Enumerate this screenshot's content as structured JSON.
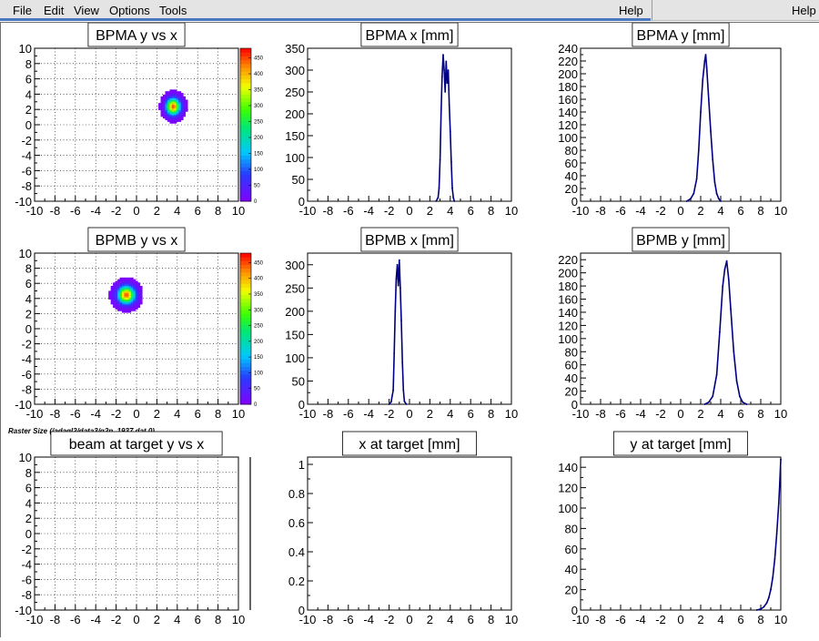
{
  "menu": {
    "items": [
      "File",
      "Edit",
      "View",
      "Options",
      "Tools"
    ],
    "help_left": "Help",
    "help_right": "Help"
  },
  "note": "Raster Size (/adaql2/data3/g2p_1937.dat.0)",
  "colors": {
    "frame": "#000000",
    "grid": "#000000",
    "hist": "#000080"
  },
  "chart_data": [
    {
      "id": "bpma-yx",
      "type": "heatmap",
      "title": "BPMA y vs x",
      "xlim": [
        -10,
        10
      ],
      "ylim": [
        -10,
        10
      ],
      "xticks": [
        -10,
        -8,
        -6,
        -4,
        -2,
        0,
        2,
        4,
        6,
        8,
        10
      ],
      "yticks": [
        -10,
        -8,
        -6,
        -4,
        -2,
        0,
        2,
        4,
        6,
        8,
        10
      ],
      "grid": true,
      "blob": {
        "cx": 3.5,
        "cy": 2.3,
        "sx": 0.45,
        "sy": 0.7,
        "peak": 450
      },
      "palette": {
        "min": 0,
        "max": 480,
        "ticks": [
          0,
          50,
          100,
          150,
          200,
          250,
          300,
          350,
          400,
          450
        ]
      }
    },
    {
      "id": "bpma-x",
      "type": "line",
      "title": "BPMA x [mm]",
      "xlim": [
        -10,
        10
      ],
      "ylim": [
        0,
        350
      ],
      "xticks": [
        -10,
        -8,
        -6,
        -4,
        -2,
        0,
        2,
        4,
        6,
        8,
        10
      ],
      "yticks": [
        0,
        50,
        100,
        150,
        200,
        250,
        300,
        350
      ],
      "grid": false,
      "x": [
        2.6,
        2.8,
        2.9,
        3.0,
        3.1,
        3.2,
        3.3,
        3.4,
        3.5,
        3.6,
        3.7,
        3.8,
        3.9,
        4.0,
        4.1,
        4.2,
        4.3,
        4.4
      ],
      "y": [
        0,
        8,
        30,
        95,
        200,
        285,
        335,
        300,
        250,
        320,
        270,
        300,
        220,
        160,
        90,
        30,
        8,
        0
      ]
    },
    {
      "id": "bpma-y",
      "type": "line",
      "title": "BPMA y [mm]",
      "xlim": [
        -10,
        10
      ],
      "ylim": [
        0,
        240
      ],
      "xticks": [
        -10,
        -8,
        -6,
        -4,
        -2,
        0,
        2,
        4,
        6,
        8,
        10
      ],
      "yticks": [
        0,
        20,
        40,
        60,
        80,
        100,
        120,
        140,
        160,
        180,
        200,
        220,
        240
      ],
      "grid": false,
      "x": [
        0.6,
        1.0,
        1.3,
        1.6,
        1.8,
        2.0,
        2.2,
        2.4,
        2.5,
        2.6,
        2.8,
        3.0,
        3.2,
        3.4,
        3.6,
        3.8,
        4.0
      ],
      "y": [
        0,
        4,
        12,
        35,
        80,
        140,
        190,
        220,
        230,
        210,
        160,
        110,
        65,
        30,
        12,
        4,
        0
      ]
    },
    {
      "id": "bpmb-yx",
      "type": "heatmap",
      "title": "BPMB y vs x",
      "xlim": [
        -10,
        10
      ],
      "ylim": [
        -10,
        10
      ],
      "xticks": [
        -10,
        -8,
        -6,
        -4,
        -2,
        0,
        2,
        4,
        6,
        8,
        10
      ],
      "yticks": [
        -10,
        -8,
        -6,
        -4,
        -2,
        0,
        2,
        4,
        6,
        8,
        10
      ],
      "grid": true,
      "blob": {
        "cx": -1.1,
        "cy": 4.4,
        "sx": 0.55,
        "sy": 0.75,
        "peak": 450
      },
      "palette": {
        "min": 0,
        "max": 480,
        "ticks": [
          0,
          50,
          100,
          150,
          200,
          250,
          300,
          350,
          400,
          450
        ]
      }
    },
    {
      "id": "bpmb-x",
      "type": "line",
      "title": "BPMB x [mm]",
      "xlim": [
        -10,
        10
      ],
      "ylim": [
        0,
        325
      ],
      "xticks": [
        -10,
        -8,
        -6,
        -4,
        -2,
        0,
        2,
        4,
        6,
        8,
        10
      ],
      "yticks": [
        0,
        50,
        100,
        150,
        200,
        250,
        300
      ],
      "grid": false,
      "x": [
        -2.0,
        -1.8,
        -1.6,
        -1.5,
        -1.4,
        -1.3,
        -1.2,
        -1.1,
        -1.0,
        -0.9,
        -0.8,
        -0.7,
        -0.6,
        -0.5,
        -0.3
      ],
      "y": [
        0,
        5,
        30,
        110,
        200,
        270,
        300,
        255,
        310,
        250,
        180,
        90,
        30,
        6,
        0
      ]
    },
    {
      "id": "bpmb-y",
      "type": "line",
      "title": "BPMB y [mm]",
      "xlim": [
        -10,
        10
      ],
      "ylim": [
        0,
        230
      ],
      "xticks": [
        -10,
        -8,
        -6,
        -4,
        -2,
        0,
        2,
        4,
        6,
        8,
        10
      ],
      "yticks": [
        0,
        20,
        40,
        60,
        80,
        100,
        120,
        140,
        160,
        180,
        200,
        220
      ],
      "grid": false,
      "x": [
        2.4,
        2.8,
        3.2,
        3.6,
        3.9,
        4.2,
        4.4,
        4.6,
        4.8,
        5.0,
        5.3,
        5.6,
        5.9,
        6.2,
        6.6
      ],
      "y": [
        0,
        3,
        12,
        45,
        110,
        180,
        205,
        218,
        190,
        145,
        80,
        35,
        12,
        3,
        0
      ]
    },
    {
      "id": "target-yx",
      "type": "heatmap",
      "title": "beam at target y vs x",
      "xlim": [
        -10,
        10
      ],
      "ylim": [
        -10,
        10
      ],
      "xticks": [
        -10,
        -8,
        -6,
        -4,
        -2,
        0,
        2,
        4,
        6,
        8,
        10
      ],
      "yticks": [
        -10,
        -8,
        -6,
        -4,
        -2,
        0,
        2,
        4,
        6,
        8,
        10
      ],
      "grid": true,
      "blob": null,
      "palette": null
    },
    {
      "id": "target-x",
      "type": "line",
      "title": "x at target [mm]",
      "xlim": [
        -10,
        10
      ],
      "ylim": [
        0,
        1.05
      ],
      "xticks": [
        -10,
        -8,
        -6,
        -4,
        -2,
        0,
        2,
        4,
        6,
        8,
        10
      ],
      "yticks": [
        0,
        0.2,
        0.4,
        0.6,
        0.8,
        1
      ],
      "grid": false,
      "x": [],
      "y": []
    },
    {
      "id": "target-y",
      "type": "line",
      "title": "y at target [mm]",
      "xlim": [
        -10,
        10
      ],
      "ylim": [
        0,
        150
      ],
      "xticks": [
        -10,
        -8,
        -6,
        -4,
        -2,
        0,
        2,
        4,
        6,
        8,
        10
      ],
      "yticks": [
        0,
        20,
        40,
        60,
        80,
        100,
        120,
        140
      ],
      "grid": false,
      "x": [
        7.6,
        8.0,
        8.3,
        8.6,
        8.8,
        9.0,
        9.2,
        9.4,
        9.6,
        9.8,
        9.9,
        10.0
      ],
      "y": [
        0,
        1,
        3,
        7,
        12,
        20,
        32,
        50,
        75,
        105,
        125,
        148
      ]
    }
  ]
}
